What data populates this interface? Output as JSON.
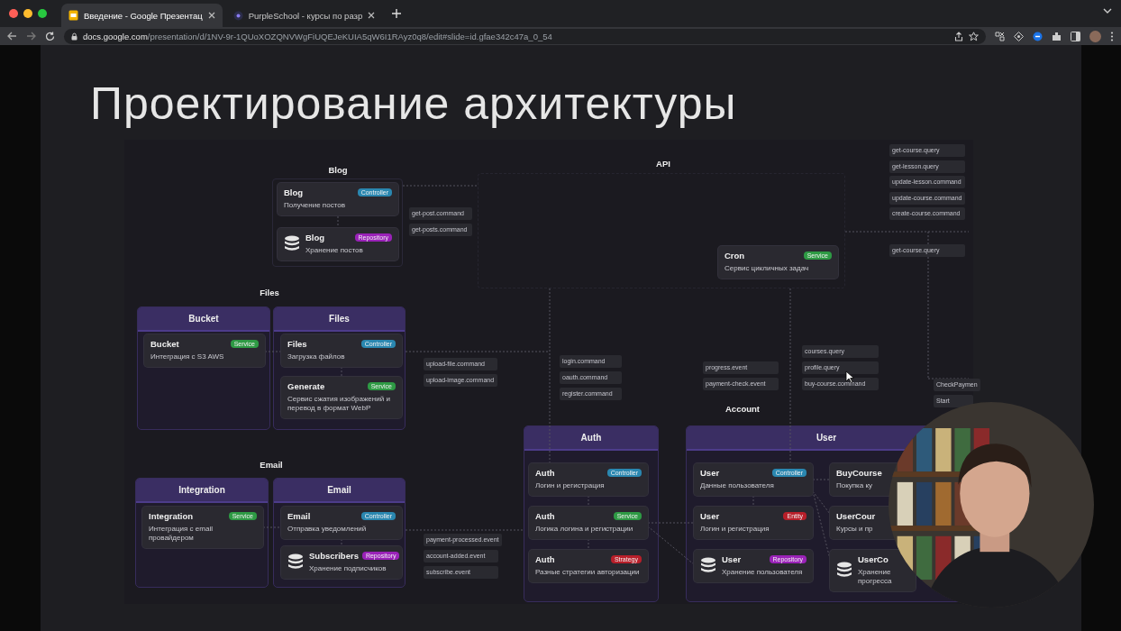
{
  "browser": {
    "tabs": [
      {
        "title": "Введение - Google Презентац",
        "selected": true
      },
      {
        "title": "PurpleSchool - курсы по разр",
        "selected": false
      }
    ],
    "url": {
      "host": "docs.google.com",
      "path": "/presentation/d/1NV-9r-1QUoXOZQNVWgFiUQEJeKUIA5qW6I1RAyz0q8/edit#slide=id.gfae342c47a_0_54"
    }
  },
  "slide": {
    "title": "Проектирование архитектуры",
    "groups": [
      {
        "label": "Blog"
      },
      {
        "label": "Files"
      },
      {
        "label": "Email"
      },
      {
        "label": "API"
      },
      {
        "label": "Account"
      }
    ],
    "modules": [
      {
        "title": "Bucket"
      },
      {
        "title": "Files"
      },
      {
        "title": "Integration"
      },
      {
        "title": "Email"
      },
      {
        "title": "Auth"
      },
      {
        "title": "User"
      }
    ],
    "cards": [
      {
        "kind": "service",
        "title": "Blog",
        "description": "Получение постов",
        "badge": {
          "label": "Controller",
          "color": "#2a87b0"
        }
      },
      {
        "kind": "database",
        "title": "Blog",
        "description": "Хранение постов",
        "badge": {
          "label": "Repository",
          "color": "#9a22b8"
        }
      },
      {
        "kind": "service",
        "title": "Bucket",
        "description": "Интеграция с S3 AWS",
        "badge": {
          "label": "Service",
          "color": "#2e9a44"
        }
      },
      {
        "kind": "service",
        "title": "Files",
        "description": "Загрузка файлов",
        "badge": {
          "label": "Controller",
          "color": "#2a87b0"
        }
      },
      {
        "kind": "service",
        "title": "Generate",
        "description": "Сервис сжатия изображений и перевод в формат WebP",
        "badge": {
          "label": "Service",
          "color": "#2e9a44"
        }
      },
      {
        "kind": "service",
        "title": "Cron",
        "description": "Сервис цикличных задач",
        "badge": {
          "label": "Service",
          "color": "#2e9a44"
        }
      },
      {
        "kind": "service",
        "title": "Integration",
        "description": "Интеграция с email провайдером",
        "badge": {
          "label": "Service",
          "color": "#2e9a44"
        }
      },
      {
        "kind": "service",
        "title": "Email",
        "description": "Отправка уведомлений",
        "badge": {
          "label": "Controller",
          "color": "#2a87b0"
        }
      },
      {
        "kind": "database",
        "title": "Subscribers",
        "description": "Хранение подписчиков",
        "badge": {
          "label": "Repository",
          "color": "#9a22b8"
        }
      },
      {
        "kind": "service",
        "title": "Auth",
        "description": "Логин и регистрация",
        "badge": {
          "label": "Controller",
          "color": "#2a87b0"
        }
      },
      {
        "kind": "service",
        "title": "Auth",
        "description": "Логика логина и регистрации",
        "badge": {
          "label": "Service",
          "color": "#2e9a44"
        }
      },
      {
        "kind": "service",
        "title": "Auth",
        "description": "Разные стратегии авторизации",
        "badge": {
          "label": "Strategy",
          "color": "#b81f2a"
        }
      },
      {
        "kind": "service",
        "title": "User",
        "description": "Данные пользователя",
        "badge": {
          "label": "Controller",
          "color": "#2a87b0"
        }
      },
      {
        "kind": "service",
        "title": "User",
        "description": "Логин и регистрация",
        "badge": {
          "label": "Entity",
          "color": "#b81f2a"
        }
      },
      {
        "kind": "database",
        "title": "User",
        "description": "Хранение пользователя",
        "badge": {
          "label": "Repository",
          "color": "#9a22b8"
        }
      },
      {
        "kind": "service",
        "title": "BuyCourse",
        "description": "Покупка ку"
      },
      {
        "kind": "service",
        "title": "UserCour",
        "description": "Курсы и пр"
      },
      {
        "kind": "database",
        "title": "UserCo",
        "description": "Хранение прогресса"
      }
    ],
    "messages": [
      {
        "text": "get-post.command"
      },
      {
        "text": "get-posts.command"
      },
      {
        "text": "upload-file.command"
      },
      {
        "text": "upload-image.command"
      },
      {
        "text": "login.command"
      },
      {
        "text": "oauth.command"
      },
      {
        "text": "register.command"
      },
      {
        "text": "progress.event"
      },
      {
        "text": "payment-check.event"
      },
      {
        "text": "courses.query"
      },
      {
        "text": "profile.query"
      },
      {
        "text": "buy-course.command"
      },
      {
        "text": "get-course.query"
      },
      {
        "text": "get-lesson.query"
      },
      {
        "text": "update-lesson.command"
      },
      {
        "text": "update-course.command"
      },
      {
        "text": "create-course.command"
      },
      {
        "text": "get-course.query"
      },
      {
        "text": "payment-processed.event"
      },
      {
        "text": "account-added.event"
      },
      {
        "text": "subscribe.event"
      },
      {
        "text": "CheckPaymen"
      },
      {
        "text": "Start"
      }
    ]
  }
}
